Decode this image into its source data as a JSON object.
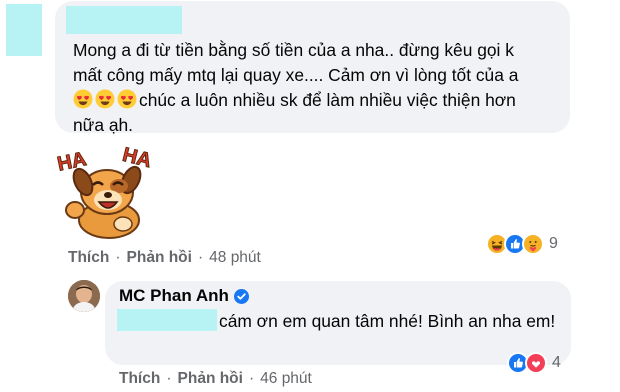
{
  "comment": {
    "text_line1": "Mong a đi từ tiền bằng số tiền của a nha.. đừng kêu gọi k",
    "text_line2": "mất công mấy mtq lại quay xe.... Cảm ơn vì lòng tốt của a",
    "text_line3": "chúc a luôn nhiều sk để làm nhiều việc thiện hơn",
    "text_line4": "nữa ạh.",
    "sticker_text": "HA HA",
    "actions": {
      "like": "Thích",
      "reply": "Phản hồi",
      "separator": "·",
      "time": "48 phút"
    },
    "reaction_count": "9"
  },
  "reply": {
    "author": "MC Phan Anh",
    "text": "cám ơn em quan tâm nhé! Bình an nha em!",
    "actions": {
      "like": "Thích",
      "reply": "Phản hồi",
      "separator": "·",
      "time": "46 phút"
    },
    "reaction_count": "4"
  },
  "colors": {
    "bubble": "#f0f2f5",
    "redaction": "#b7f2f5",
    "muted": "#65676b",
    "text": "#050505",
    "like_blue": "#1877f2",
    "love_red": "#f33e58",
    "haha_yellow": "#f7b125"
  },
  "icons": [
    "heart-eyes-emoji",
    "haha-dog-sticker",
    "haha-reaction-icon",
    "like-reaction-icon",
    "care-reaction-icon",
    "love-reaction-icon",
    "verified-badge-icon"
  ]
}
